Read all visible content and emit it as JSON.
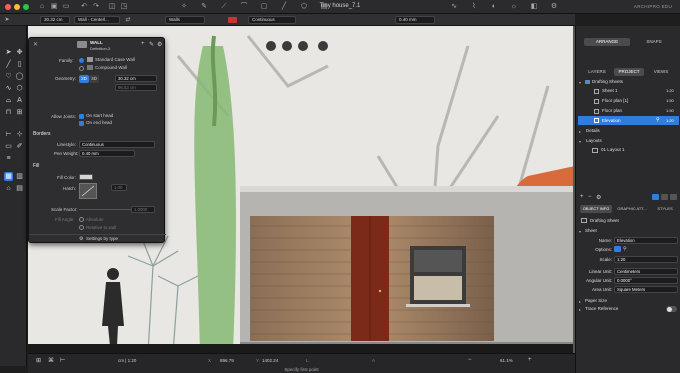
{
  "window": {
    "title": "Tiny house_7.1",
    "edition": "ARCHIPRO EDU"
  },
  "modebar": {
    "length_value": "30.32 cm",
    "wall_mode": "Wall - Centerl...",
    "class_value": "Walls",
    "linestyle": "Continuous",
    "pen_weight": "0.40 mm"
  },
  "palette": {
    "header_type": "WALL",
    "header_definition": "Definition-3",
    "family_label": "Family:",
    "family_options": [
      "Standard Case Wall",
      "Compound Wall"
    ],
    "geometry_label": "Geometry:",
    "geometry_value": "30.32 cm",
    "geometry_value2": "96.53 cm",
    "geometry_seg_a": "2D",
    "geometry_seg_b": "3D",
    "allow_joints_label": "Allow Joints:",
    "joint_options": [
      "On start head",
      "On end head"
    ],
    "borders_title": "Borders",
    "linestyle_label": "Linestyle:",
    "linestyle_value": "Continuous",
    "pen_weight_label": "Pen Weight:",
    "pen_weight_value": "0.40 mm",
    "fill_title": "Fill",
    "fill_color_label": "Fill Color:",
    "hatch_label": "Hatch:",
    "hatch_value": "1.00",
    "scale_factor_label": "Scale Factor:",
    "scale_factor_value": "1.0000",
    "fill_angle_label": "Fill Angle:",
    "fill_angle_options": [
      "Absolute",
      "Relative to wall"
    ],
    "footer": "Settings by type"
  },
  "status": {
    "zoom_text": "cm | 1:20",
    "x_label": "X",
    "x_value": "896.79",
    "y_label": "Y",
    "y_value": "1402.24",
    "l_label": "L",
    "a_label": "A",
    "zoom_percent": "61.1%",
    "hint": "Specify first point"
  },
  "right": {
    "top_tabs": [
      "ARRANGE",
      "SNAPS"
    ],
    "tabs": [
      "LAYERS",
      "PROJECT",
      "VIEWS"
    ],
    "drafting_sheets": "Drafting Sheets",
    "sheets": [
      {
        "name": "Sheet 1",
        "scale": "1:20"
      },
      {
        "name": "Floor plan [1]",
        "scale": "1:50"
      },
      {
        "name": "Floor plan",
        "scale": "1:50"
      },
      {
        "name": "Elevation",
        "scale": "1:20"
      }
    ],
    "details": "Details",
    "layouts": "Layouts",
    "layout_item": "01 Layout 1",
    "info_tabs": [
      "OBJECT INFO",
      "GRAPHIC ATT...",
      "STYLES"
    ],
    "object_type": "Drafting Sheet",
    "sheet_section": "Sheet",
    "name_label": "Name:",
    "name_value": "Elevation",
    "options_label": "Options:",
    "scale_label": "Scale:",
    "scale_value": "1:20",
    "linear_unit_label": "Linear Unit:",
    "linear_unit_value": "Centimeters",
    "angular_unit_label": "Angular Unit:",
    "angular_unit_value": "0.0000°",
    "area_unit_label": "Area Unit:",
    "area_unit_value": "Square Meters",
    "paper_size": "Paper Size",
    "trace_reference": "Trace Reference"
  },
  "colors": {
    "accent": "#2f7ddc",
    "door": "#7a2a16",
    "tree_green": "#7fb56a",
    "tree_orange": "#d66a3c"
  }
}
